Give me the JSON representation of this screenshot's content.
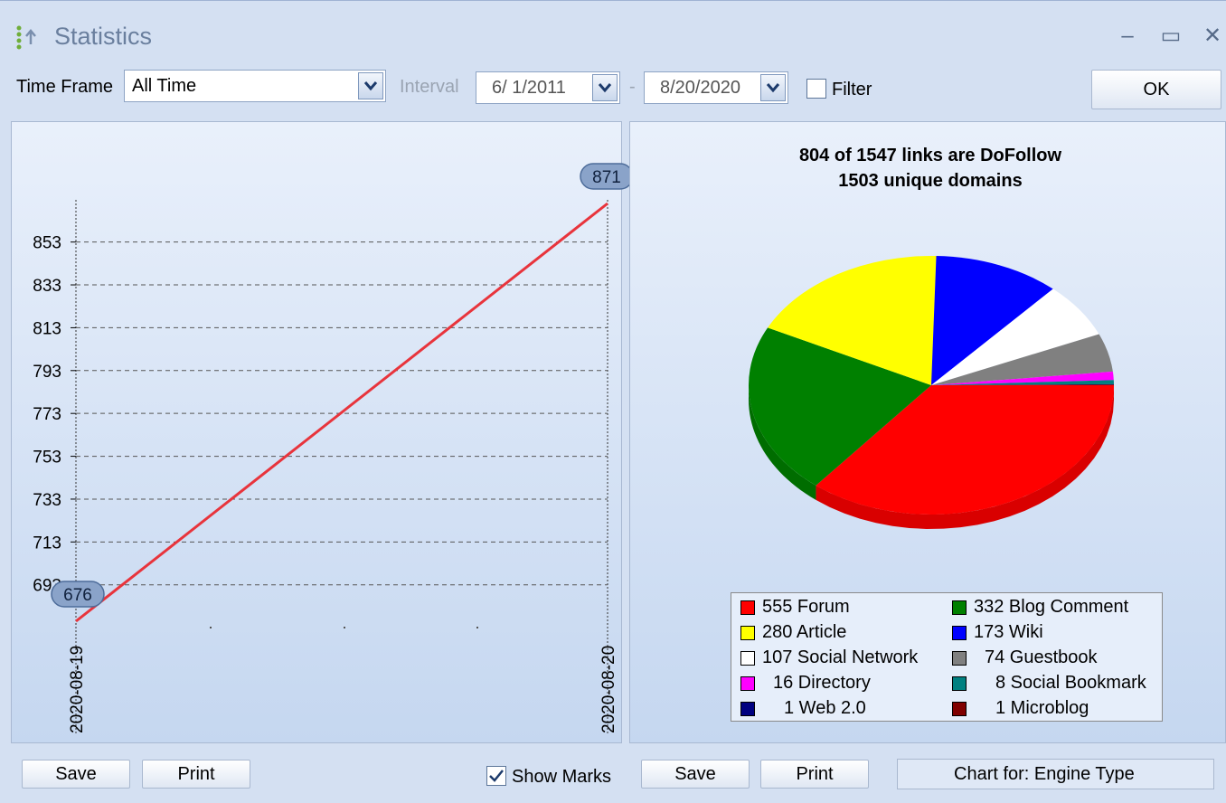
{
  "window": {
    "title": "Statistics",
    "minimize": "–",
    "maximize": "▭",
    "close": "✕"
  },
  "toolbar": {
    "timeframe_label": "Time Frame",
    "timeframe_value": "All Time",
    "interval_label": "Interval",
    "date_from": "6/  1/2011",
    "date_sep": "-",
    "date_to": "8/20/2020",
    "filter_label": "Filter",
    "filter_checked": false,
    "ok_label": "OK"
  },
  "left_panel": {
    "save_label": "Save",
    "print_label": "Print",
    "show_marks_label": "Show Marks",
    "show_marks_checked": true
  },
  "right_panel": {
    "save_label": "Save",
    "print_label": "Print",
    "chart_for_label": "Chart for:  Engine Type"
  },
  "chart_data": [
    {
      "type": "line",
      "x": [
        "2020-08-19",
        "2020-08-20"
      ],
      "series": [
        {
          "values": [
            676,
            871
          ],
          "color": "#e8343c"
        }
      ],
      "marks": [
        "676",
        "871"
      ],
      "yticks": [
        693,
        713,
        733,
        753,
        773,
        793,
        813,
        833,
        853
      ],
      "ylim": [
        676,
        871
      ],
      "grid": true
    },
    {
      "type": "pie",
      "title": "804 of 1547 links are DoFollow",
      "subtitle": "1503 unique domains",
      "slices": [
        {
          "label": "555 Forum",
          "value": 555,
          "color": "#ff0000"
        },
        {
          "label": "332 Blog Comment",
          "value": 332,
          "color": "#008000"
        },
        {
          "label": "280 Article",
          "value": 280,
          "color": "#ffff00"
        },
        {
          "label": "173 Wiki",
          "value": 173,
          "color": "#0000ff"
        },
        {
          "label": "107 Social Network",
          "value": 107,
          "color": "#ffffff"
        },
        {
          "label": "74 Guestbook",
          "value": 74,
          "color": "#808080"
        },
        {
          "label": "16 Directory",
          "value": 16,
          "color": "#ff00ff"
        },
        {
          "label": "8 Social Bookmark",
          "value": 8,
          "color": "#008080"
        },
        {
          "label": "1 Web 2.0",
          "value": 1,
          "color": "#000080"
        },
        {
          "label": "1 Microblog",
          "value": 1,
          "color": "#800000"
        }
      ],
      "legend": "bottom"
    }
  ]
}
